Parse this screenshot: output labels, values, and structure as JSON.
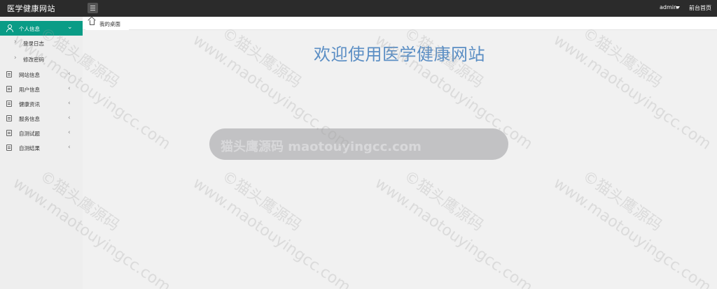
{
  "header": {
    "brand": "医学健康网站",
    "menu_icon": "hamburger-icon",
    "user": "admin",
    "front_link": "前台首页"
  },
  "sidebar": {
    "items": [
      {
        "label": "个人信息",
        "icon": "user-icon",
        "expanded": true,
        "children": [
          {
            "label": "登录日志"
          },
          {
            "label": "修改密码"
          }
        ]
      },
      {
        "label": "网站信息",
        "icon": "list-icon"
      },
      {
        "label": "用户信息",
        "icon": "list-icon"
      },
      {
        "label": "健康资讯",
        "icon": "list-icon"
      },
      {
        "label": "服务信息",
        "icon": "list-icon"
      },
      {
        "label": "自测试题",
        "icon": "list-icon"
      },
      {
        "label": "自测结果",
        "icon": "list-icon"
      }
    ],
    "active_color": "#0a9c86"
  },
  "tabs": [
    {
      "label": "我的桌面",
      "icon": "home-icon"
    }
  ],
  "main": {
    "welcome": "欢迎使用医学健康网站",
    "welcome_color": "#5b8ec4",
    "banner": "猫头鹰源码 maotouyingcc.com"
  },
  "watermark": {
    "brand": "©猫头鹰源码",
    "site": "www.maotouyingcc.com"
  }
}
